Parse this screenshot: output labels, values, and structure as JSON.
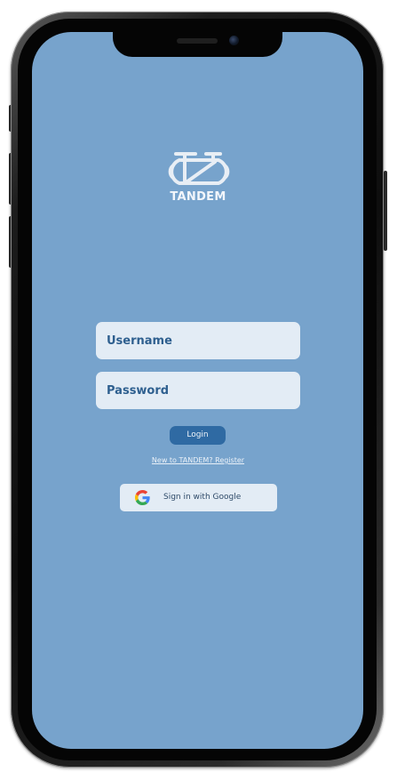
{
  "app": {
    "name": "TANDEM",
    "logo_icon": "tandem-bicycle-icon"
  },
  "login_form": {
    "username_placeholder": "Username",
    "password_placeholder": "Password",
    "login_label": "Login",
    "register_link": "New to TANDEM? Register",
    "google_label": "Sign in with Google",
    "google_icon": "google-icon"
  },
  "colors": {
    "screen_background": "#77a3cc",
    "field_background": "#e3ecf5",
    "field_text": "#2e5f8f",
    "login_button": "#2f6aa3",
    "logo": "#e8eef5"
  }
}
